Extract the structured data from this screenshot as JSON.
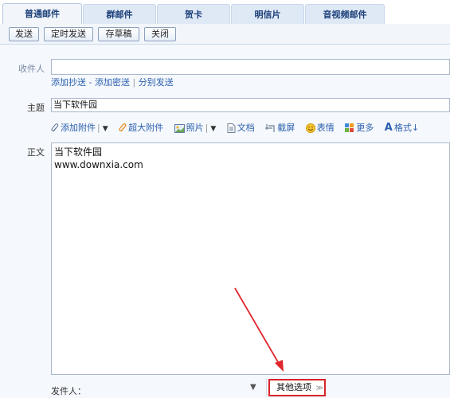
{
  "tabs": [
    "普通邮件",
    "群邮件",
    "贺卡",
    "明信片",
    "音视频邮件"
  ],
  "toolbar": {
    "send": "发送",
    "scheduled": "定时发送",
    "save_draft": "存草稿",
    "close": "关闭"
  },
  "recipients": {
    "label": "收件人",
    "value": "",
    "add_cc": "添加抄送",
    "dash": "-",
    "add_bcc": "添加密送",
    "bar": "|",
    "separate": "分别发送"
  },
  "subject": {
    "label": "主题",
    "value": "当下软件园"
  },
  "attachments": {
    "add": "添加附件",
    "big": "超大附件",
    "photo": "照片",
    "doc": "文档",
    "screenshot": "截屏",
    "emoji": "表情",
    "more": "更多",
    "format": "格式"
  },
  "body": {
    "label": "正文",
    "lines": [
      "当下软件园",
      "www.downxia.com"
    ]
  },
  "footer": {
    "sender_label": "发件人：",
    "other_options": "其他选项"
  },
  "colors": {
    "highlight": "#d8232a",
    "link": "#2a5fae",
    "tab_text": "#1a3e78"
  }
}
